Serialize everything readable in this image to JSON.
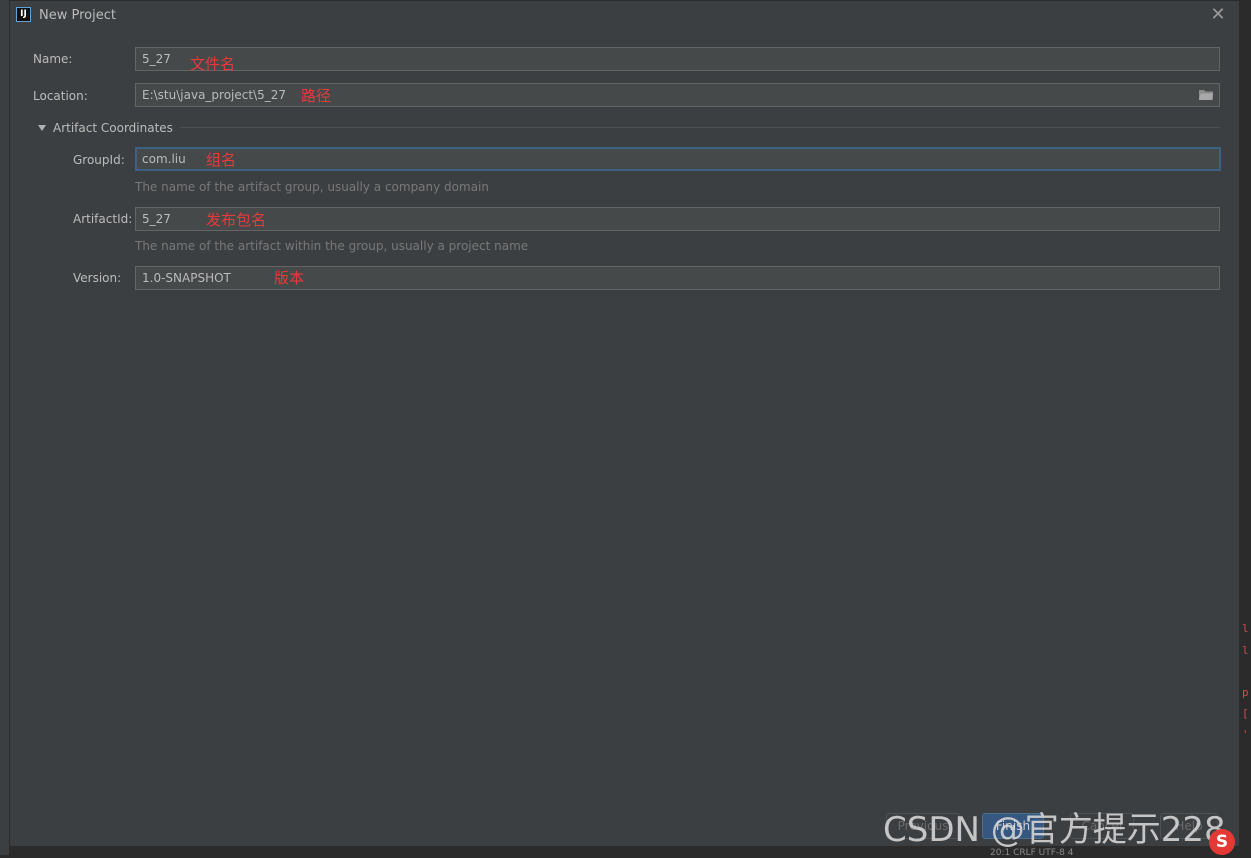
{
  "window": {
    "title": "New Project",
    "icon_text": "IJ"
  },
  "form": {
    "name": {
      "label": "Name:",
      "value": "5_27",
      "annotation": "文件名"
    },
    "location": {
      "label": "Location:",
      "value": "E:\\stu\\java_project\\5_27",
      "annotation": "路径"
    },
    "section": {
      "title": "Artifact Coordinates",
      "expanded": true
    },
    "group_id": {
      "label": "GroupId:",
      "value": "com.liu",
      "annotation": "组名",
      "hint": "The name of the artifact group, usually a company domain"
    },
    "artifact_id": {
      "label": "ArtifactId:",
      "value": "5_27",
      "annotation": "发布包名",
      "hint": "The name of the artifact within the group, usually a project name"
    },
    "version": {
      "label": "Version:",
      "value": "1.0-SNAPSHOT",
      "annotation": "版本"
    }
  },
  "footer": {
    "previous": "Previous",
    "finish": "Finish",
    "cancel": "Cancel",
    "help": "Help"
  },
  "watermark": "CSDN @官方提示228",
  "status_bar": "20:1   CRLF   UTF-8   4",
  "colors": {
    "dialog_bg": "#3c3f41",
    "field_bg": "#45494a",
    "focus_border": "#3d6185",
    "annotation": "#e83a3a",
    "primary_button": "#365880"
  }
}
